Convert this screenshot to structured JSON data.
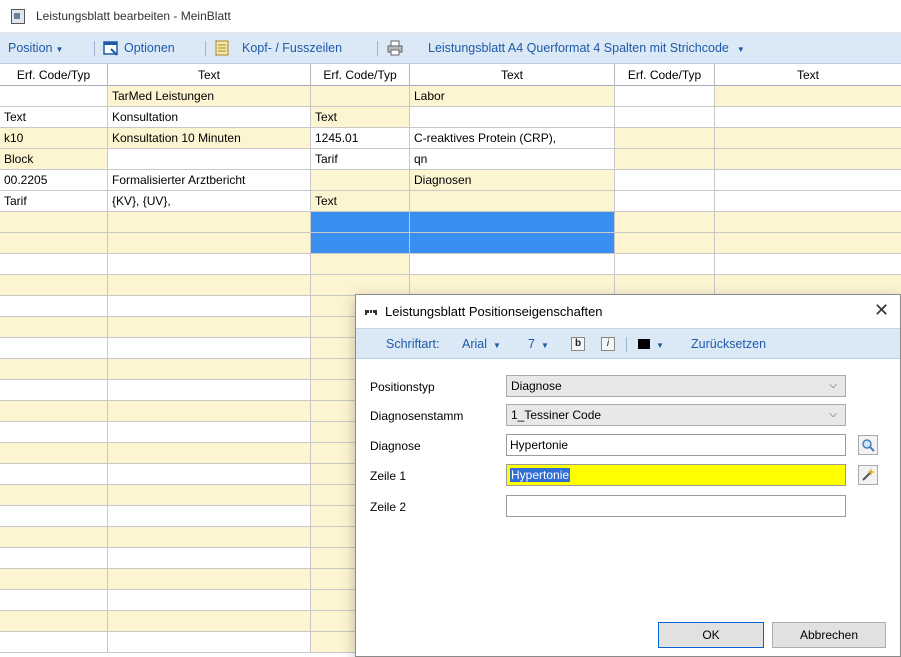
{
  "window": {
    "title": "Leistungsblatt bearbeiten - MeinBlatt"
  },
  "toolbar": {
    "position": "Position",
    "optionen": "Optionen",
    "kopf": "Kopf- / Fusszeilen",
    "layout": "Leistungsblatt A4 Querformat 4 Spalten mit Strichcode"
  },
  "columns": [
    "Erf. Code/Typ",
    "Text",
    "Erf. Code/Typ",
    "Text",
    "Erf. Code/Typ",
    "Text"
  ],
  "rows": [
    [
      "",
      "TarMed Leistungen",
      "",
      "Labor",
      "",
      ""
    ],
    [
      "Text",
      "Konsultation",
      "Text",
      "",
      "",
      ""
    ],
    [
      "k10",
      "Konsultation 10 Minuten",
      "1245.01",
      "C-reaktives Protein (CRP),",
      "",
      ""
    ],
    [
      "Block",
      "",
      "Tarif",
      "qn",
      "",
      ""
    ],
    [
      "00.2205",
      "Formalisierter Arztbericht",
      "",
      "Diagnosen",
      "",
      ""
    ],
    [
      "Tarif",
      "{KV}, {UV},",
      "Text",
      "",
      "",
      ""
    ]
  ],
  "dialog": {
    "title": "Leistungsblatt Positionseigenschaften",
    "toolbar": {
      "schriftart_label": "Schriftart:",
      "font": "Arial",
      "size": "7",
      "bold": "b",
      "italic": "i",
      "reset": "Zurücksetzen"
    },
    "positionstyp_label": "Positionstyp",
    "positionstyp_value": "Diagnose",
    "stamm_label": "Diagnosenstamm",
    "stamm_value": "1_Tessiner Code",
    "diagnose_label": "Diagnose",
    "diagnose_value": "Hypertonie",
    "zeile1_label": "Zeile 1",
    "zeile1_value": "Hypertonie",
    "zeile2_label": "Zeile 2",
    "zeile2_value": "",
    "ok": "OK",
    "cancel": "Abbrechen"
  },
  "colors": {
    "accent": "#1e5aa8",
    "row_yellow": "#fdf5d2",
    "selection_blue": "#3a8ef0",
    "highlight": "#ffff00"
  }
}
